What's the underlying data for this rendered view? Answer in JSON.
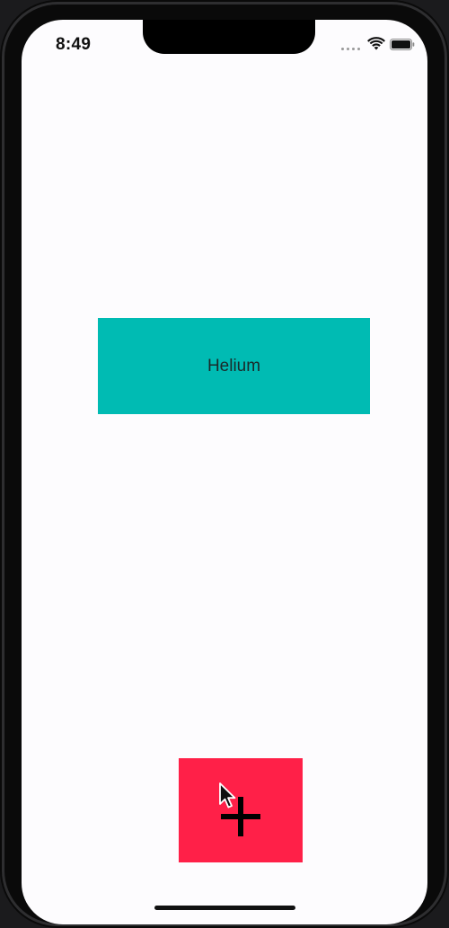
{
  "status_bar": {
    "time": "8:49",
    "icons": [
      "signal-icon",
      "wifi-icon",
      "battery-icon"
    ]
  },
  "main": {
    "element_card": {
      "label": "Helium",
      "color": "#00bbb3"
    },
    "add_button": {
      "icon": "plus-icon",
      "color": "#ff2048"
    }
  },
  "overlay": {
    "cursor": "cursor-icon"
  }
}
